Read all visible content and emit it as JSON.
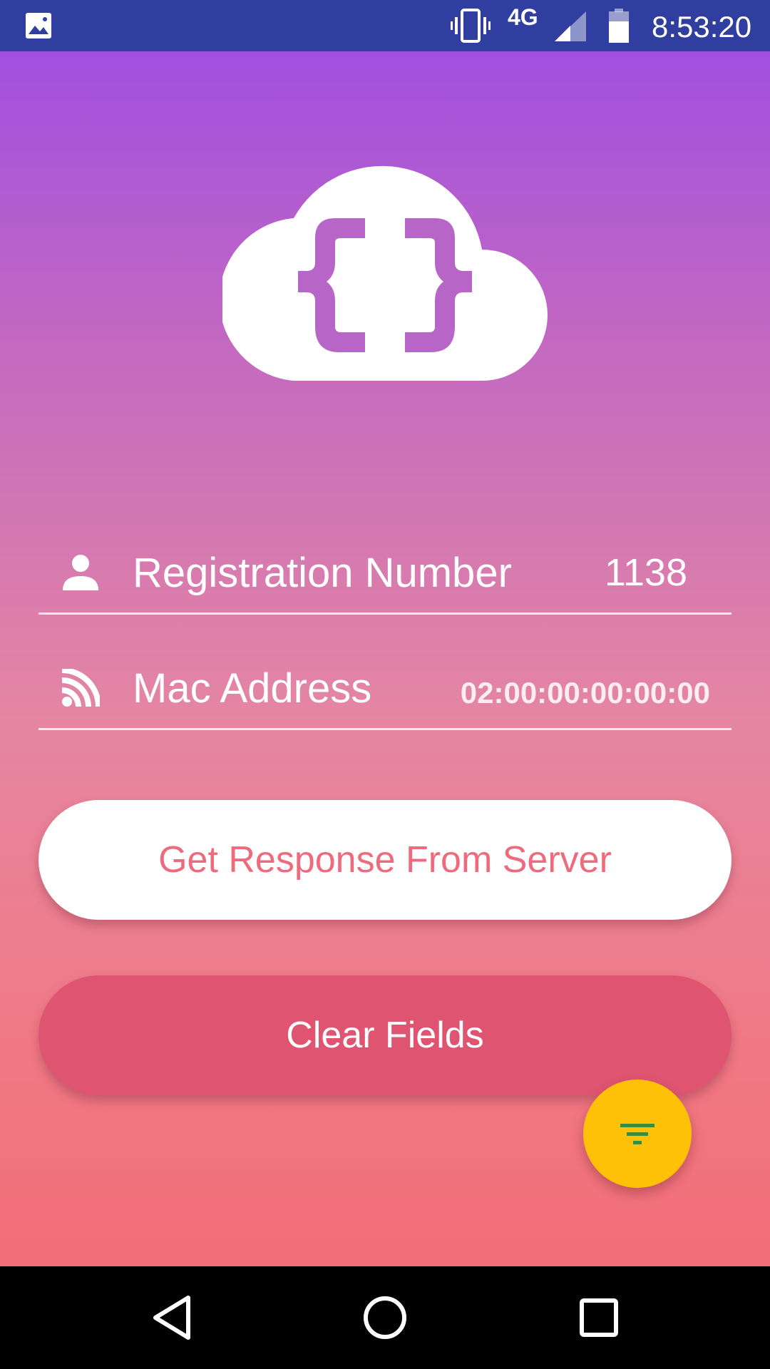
{
  "status_bar": {
    "network": "4G",
    "time": "8:53:20",
    "icons": [
      "image-icon",
      "vibrate-icon",
      "signal-icon",
      "battery-icon"
    ]
  },
  "logo": {
    "icon": "cloud-braces-icon"
  },
  "fields": {
    "registration": {
      "label": "Registration Number",
      "value": "1138",
      "icon": "person-icon"
    },
    "mac": {
      "label": "Mac Address",
      "value": "02:00:00:00:00:00",
      "icon": "rss-icon"
    }
  },
  "buttons": {
    "get_response": "Get Response From Server",
    "clear": "Clear Fields"
  },
  "fab": {
    "icon": "filter-list-icon"
  },
  "nav": {
    "icons": [
      "back-icon",
      "home-icon",
      "recents-icon"
    ]
  },
  "colors": {
    "status_bar": "#303F9F",
    "gradient_top": "#A14FE0",
    "gradient_bottom": "#F26E78",
    "get_button_text": "#EE6B7E",
    "clear_button": "#DF5571",
    "fab": "#FFC107",
    "fab_icon": "#388E3C"
  }
}
